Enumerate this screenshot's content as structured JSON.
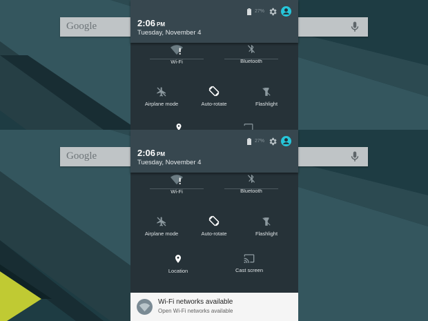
{
  "search": {
    "logo_text": "Google"
  },
  "header": {
    "time": "2:06",
    "ampm": "PM",
    "date": "Tuesday, November 4",
    "battery_text": "27%"
  },
  "tiles": {
    "wifi": "Wi-Fi",
    "bluetooth": "Bluetooth",
    "airplane": "Airplane mode",
    "autorotate": "Auto-rotate",
    "flashlight": "Flashlight",
    "location": "Location",
    "cast": "Cast screen"
  },
  "notification": {
    "title": "Wi-Fi networks available",
    "text": "Open Wi-Fi networks available"
  },
  "colors": {
    "accent": "#26c6da",
    "header_bg": "#37474f",
    "shade_bg": "#263238",
    "wallpaper_yellow": "#c0ca33"
  }
}
